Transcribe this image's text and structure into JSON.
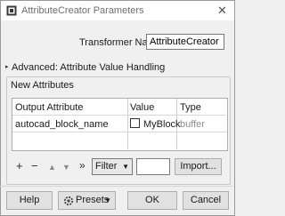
{
  "window": {
    "title": "AttributeCreator Parameters",
    "close_glyph": "✕"
  },
  "transformer": {
    "label": "Transformer Name:",
    "value": "AttributeCreator"
  },
  "advanced": {
    "label": "Advanced: Attribute Value Handling",
    "arrow_glyph": "▸"
  },
  "group": {
    "title": "New Attributes"
  },
  "table": {
    "headers": [
      "Output Attribute",
      "Value",
      "Type"
    ],
    "rows": [
      {
        "output_attribute": "autocad_block_name",
        "value": "MyBlock",
        "checked": false,
        "type": "buffer"
      }
    ]
  },
  "toolbar": {
    "add_glyph": "+",
    "remove_glyph": "−",
    "up_glyph": "▲",
    "down_glyph": "▼",
    "more_glyph": "»",
    "filter_value": "Filter",
    "filter_text": "",
    "import_label": "Import..."
  },
  "buttons": {
    "help": "Help",
    "presets": "Presets",
    "ok": "OK",
    "cancel": "Cancel"
  },
  "icons": {
    "app": "app-icon",
    "presets": "presets-gear-icon",
    "dropdown": "chevron-down-icon"
  },
  "colors": {
    "title_text": "#6e6e6e",
    "type_text": "#8c8c8c"
  }
}
